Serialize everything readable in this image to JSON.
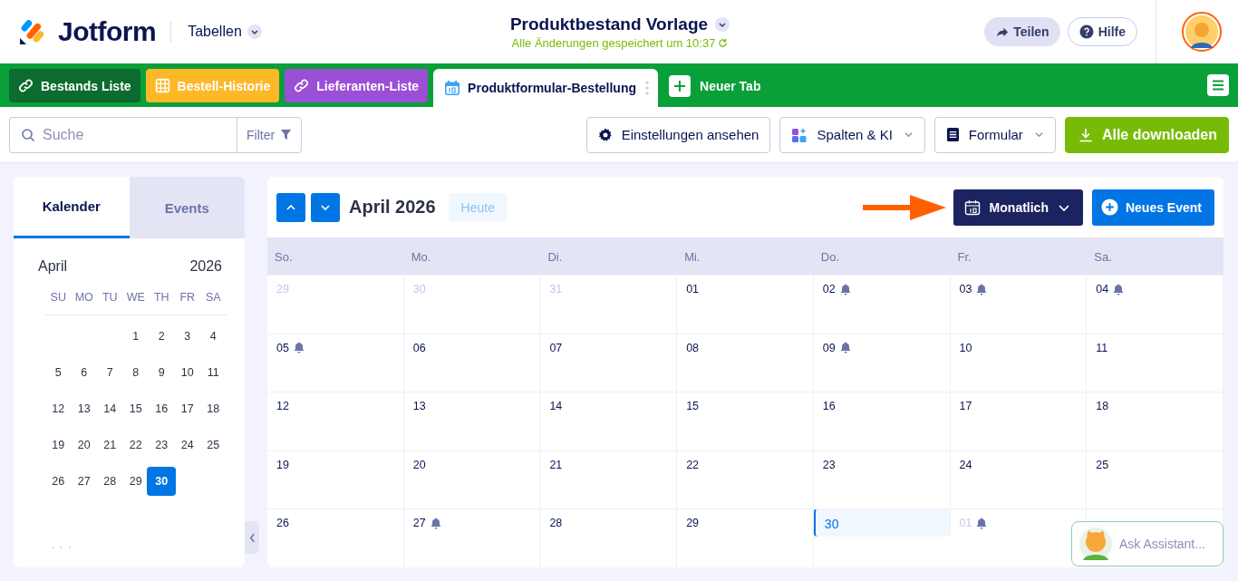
{
  "header": {
    "logo": "Jotform",
    "product_menu": "Tabellen",
    "title": "Produktbestand Vorlage",
    "save_status": "Alle Änderungen gespeichert um 10:37",
    "share_button": "Teilen",
    "help_button": "Hilfe"
  },
  "tabs": [
    {
      "label": "Bestands Liste",
      "kind": "link",
      "color": "#0c6b2e",
      "selected": false
    },
    {
      "label": "Bestell-Historie",
      "kind": "grid",
      "color": "#fdb827",
      "selected": false
    },
    {
      "label": "Lieferanten-Liste",
      "kind": "link",
      "color": "#9b4ed6",
      "selected": false
    },
    {
      "label": "Produktformular-Bestellung",
      "kind": "calendar",
      "color": "#ffffff",
      "selected": true
    }
  ],
  "new_tab": "Neuer Tab",
  "toolbar": {
    "search": {
      "placeholder": "Suche"
    },
    "filter": "Filter",
    "settings_button": "Einstellungen ansehen",
    "columns_button": "Spalten & KI",
    "form_button": "Formular",
    "download_button": "Alle downloaden"
  },
  "sidebar": {
    "tabs": [
      {
        "label": "Kalender",
        "selected": true
      },
      {
        "label": "Events",
        "selected": false
      }
    ],
    "month": "April",
    "year": "2026",
    "weekdays": [
      "SU",
      "MO",
      "TU",
      "WE",
      "TH",
      "FR",
      "SA"
    ],
    "weeks": [
      [
        {
          "day": "1",
          "selected": false
        },
        {
          "day": "2",
          "selected": false
        },
        {
          "day": "3",
          "selected": false
        },
        {
          "day": "4",
          "selected": false
        }
      ],
      [
        {
          "day": "5",
          "selected": false
        },
        {
          "day": "6",
          "selected": false
        },
        {
          "day": "7",
          "selected": false
        },
        {
          "day": "8",
          "selected": false
        },
        {
          "day": "9",
          "selected": false
        },
        {
          "day": "10",
          "selected": false
        },
        {
          "day": "11",
          "selected": false
        }
      ],
      [
        {
          "day": "12",
          "selected": false
        },
        {
          "day": "13",
          "selected": false
        },
        {
          "day": "14",
          "selected": false
        },
        {
          "day": "15",
          "selected": false
        },
        {
          "day": "16",
          "selected": false
        },
        {
          "day": "17",
          "selected": false
        },
        {
          "day": "18",
          "selected": false
        }
      ],
      [
        {
          "day": "19",
          "selected": false
        },
        {
          "day": "20",
          "selected": false
        },
        {
          "day": "21",
          "selected": false
        },
        {
          "day": "22",
          "selected": false
        },
        {
          "day": "23",
          "selected": false
        },
        {
          "day": "24",
          "selected": false
        },
        {
          "day": "25",
          "selected": false
        }
      ],
      [
        {
          "day": "26",
          "selected": false
        },
        {
          "day": "27",
          "selected": false
        },
        {
          "day": "28",
          "selected": false
        },
        {
          "day": "29",
          "selected": false
        },
        {
          "day": "30",
          "selected": true
        }
      ]
    ]
  },
  "calendar": {
    "title": "April 2026",
    "today_button": "Heute",
    "view_button": "Monatlich",
    "new_event_button": "Neues Event",
    "columns": [
      "So.",
      "Mo.",
      "Di.",
      "Mi.",
      "Do.",
      "Fr.",
      "Sa."
    ],
    "weeks": [
      [
        {
          "date": "29",
          "muted": true,
          "today": false,
          "reminder": false
        },
        {
          "date": "30",
          "muted": true,
          "today": false,
          "reminder": false
        },
        {
          "date": "31",
          "muted": true,
          "today": false,
          "reminder": false
        },
        {
          "date": "01",
          "muted": false,
          "today": false,
          "reminder": false
        },
        {
          "date": "02",
          "muted": false,
          "today": false,
          "reminder": true
        },
        {
          "date": "03",
          "muted": false,
          "today": false,
          "reminder": true
        },
        {
          "date": "04",
          "muted": false,
          "today": false,
          "reminder": true
        }
      ],
      [
        {
          "date": "05",
          "muted": false,
          "today": false,
          "reminder": true
        },
        {
          "date": "06",
          "muted": false,
          "today": false,
          "reminder": false
        },
        {
          "date": "07",
          "muted": false,
          "today": false,
          "reminder": false
        },
        {
          "date": "08",
          "muted": false,
          "today": false,
          "reminder": false
        },
        {
          "date": "09",
          "muted": false,
          "today": false,
          "reminder": true
        },
        {
          "date": "10",
          "muted": false,
          "today": false,
          "reminder": false
        },
        {
          "date": "11",
          "muted": false,
          "today": false,
          "reminder": false
        }
      ],
      [
        {
          "date": "12",
          "muted": false,
          "today": false,
          "reminder": false
        },
        {
          "date": "13",
          "muted": false,
          "today": false,
          "reminder": false
        },
        {
          "date": "14",
          "muted": false,
          "today": false,
          "reminder": false
        },
        {
          "date": "15",
          "muted": false,
          "today": false,
          "reminder": false
        },
        {
          "date": "16",
          "muted": false,
          "today": false,
          "reminder": false
        },
        {
          "date": "17",
          "muted": false,
          "today": false,
          "reminder": false
        },
        {
          "date": "18",
          "muted": false,
          "today": false,
          "reminder": false
        }
      ],
      [
        {
          "date": "19",
          "muted": false,
          "today": false,
          "reminder": false
        },
        {
          "date": "20",
          "muted": false,
          "today": false,
          "reminder": false
        },
        {
          "date": "21",
          "muted": false,
          "today": false,
          "reminder": false
        },
        {
          "date": "22",
          "muted": false,
          "today": false,
          "reminder": false
        },
        {
          "date": "23",
          "muted": false,
          "today": false,
          "reminder": false
        },
        {
          "date": "24",
          "muted": false,
          "today": false,
          "reminder": false
        },
        {
          "date": "25",
          "muted": false,
          "today": false,
          "reminder": false
        }
      ],
      [
        {
          "date": "26",
          "muted": false,
          "today": false,
          "reminder": false
        },
        {
          "date": "27",
          "muted": false,
          "today": false,
          "reminder": true
        },
        {
          "date": "28",
          "muted": false,
          "today": false,
          "reminder": false
        },
        {
          "date": "29",
          "muted": false,
          "today": false,
          "reminder": false
        },
        {
          "date": "30",
          "muted": false,
          "today": true,
          "reminder": false
        },
        {
          "date": "01",
          "muted": true,
          "today": false,
          "reminder": true
        }
      ]
    ]
  },
  "assistant": {
    "label": "Ask Assistant..."
  }
}
